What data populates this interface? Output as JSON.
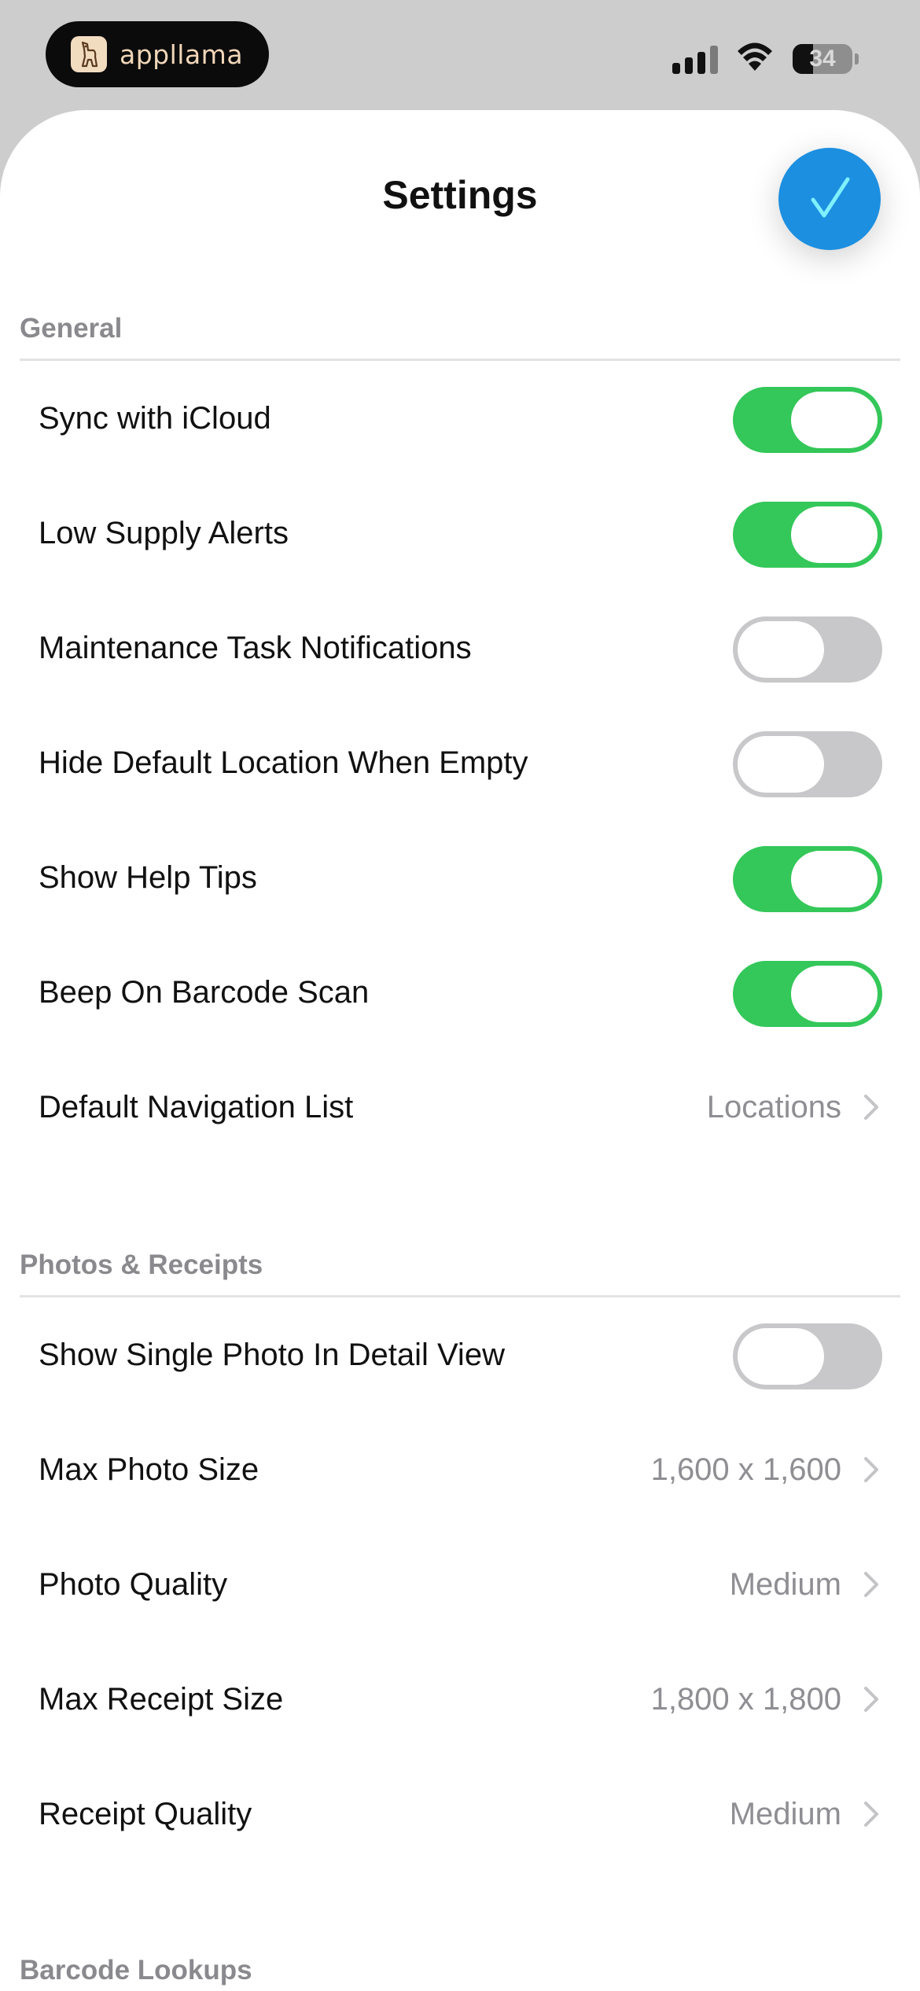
{
  "status_bar": {
    "app_name": "appllama",
    "battery_level": "34",
    "battery_fraction": 0.34,
    "icons": [
      "cellular-signal-icon",
      "wifi-icon",
      "battery-icon"
    ]
  },
  "sheet": {
    "title": "Settings",
    "done_icon": "checkmark-icon"
  },
  "sections": {
    "general": {
      "header": "General",
      "rows": [
        {
          "label": "Sync with iCloud",
          "toggle": true
        },
        {
          "label": "Low Supply Alerts",
          "toggle": true
        },
        {
          "label": "Maintenance Task Notifications",
          "toggle": false
        },
        {
          "label": "Hide Default Location When Empty",
          "toggle": false
        },
        {
          "label": "Show Help Tips",
          "toggle": true
        },
        {
          "label": "Beep On Barcode Scan",
          "toggle": true
        },
        {
          "label": "Default Navigation List",
          "value": "Locations"
        }
      ]
    },
    "photos": {
      "header": "Photos & Receipts",
      "rows": [
        {
          "label": "Show Single Photo In Detail View",
          "toggle": false
        },
        {
          "label": "Max Photo Size",
          "value": "1,600 x 1,600"
        },
        {
          "label": "Photo Quality",
          "value": "Medium"
        },
        {
          "label": "Max Receipt Size",
          "value": "1,800 x 1,800"
        },
        {
          "label": "Receipt Quality",
          "value": "Medium"
        }
      ]
    },
    "barcode": {
      "header": "Barcode Lookups"
    }
  },
  "colors": {
    "toggle_on": "#34c759",
    "toggle_off": "#c8c8ca",
    "accent": "#1c8fe0",
    "secondary_text": "#8e8e93"
  }
}
